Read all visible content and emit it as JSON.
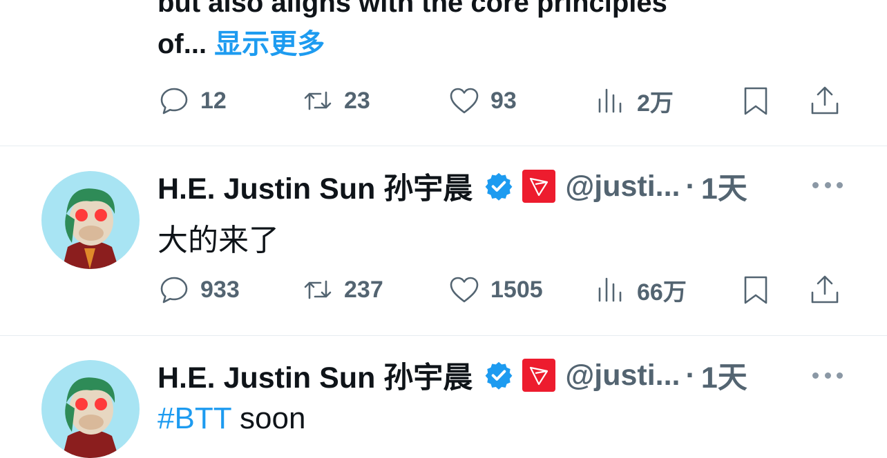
{
  "top_tweet": {
    "text_line1": "but also aligns with the core principles",
    "text_line2": "of...",
    "show_more": "显示更多",
    "stats": {
      "reply": "12",
      "retweet": "23",
      "like": "93",
      "views": "2万"
    }
  },
  "tweets": [
    {
      "name": "H.E. Justin Sun 孙宇晨",
      "handle": "@justi...",
      "separator": "·",
      "time": "1天",
      "text": "大的来了",
      "stats": {
        "reply": "933",
        "retweet": "237",
        "like": "1505",
        "views": "66万"
      }
    },
    {
      "name": "H.E. Justin Sun 孙宇晨",
      "handle": "@justi...",
      "separator": "·",
      "time": "1天",
      "text_hashtag": "#BTT",
      "text_rest": " soon"
    }
  ],
  "colors": {
    "link": "#1d9bf0",
    "muted": "#536471",
    "tron_red": "#ed1c2e",
    "avatar_bg": "#a8e4f3"
  },
  "icons": [
    "reply-icon",
    "retweet-icon",
    "like-icon",
    "views-icon",
    "bookmark-icon",
    "share-icon",
    "verified-badge-icon",
    "tron-logo-icon",
    "more-options-icon"
  ]
}
